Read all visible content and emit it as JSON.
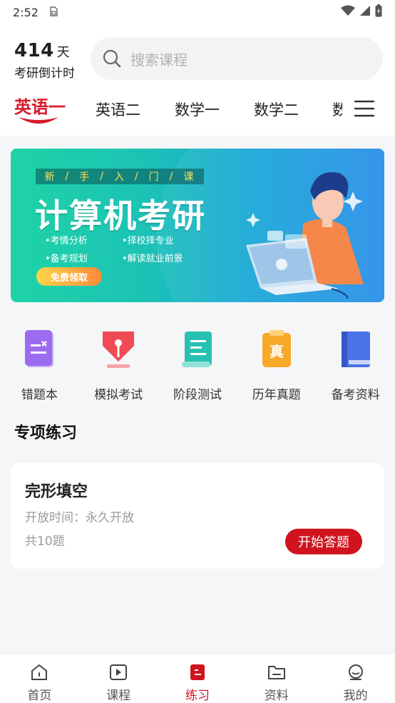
{
  "status_bar": {
    "time": "2:52"
  },
  "countdown": {
    "days": "414",
    "unit": "天",
    "label": "考研倒计时"
  },
  "search": {
    "placeholder": "搜索课程",
    "icon": "search-icon"
  },
  "subject_tabs": [
    {
      "label": "英语一",
      "active": true
    },
    {
      "label": "英语二",
      "active": false
    },
    {
      "label": "数学一",
      "active": false
    },
    {
      "label": "数学二",
      "active": false
    },
    {
      "label": "数",
      "active": false
    }
  ],
  "banner": {
    "tagline": [
      "新",
      "/",
      "手",
      "/",
      "入",
      "/",
      "门",
      "/",
      "课"
    ],
    "headline": "计算机考研",
    "bullets": [
      "•考情分析",
      "•择校择专业",
      "•备考规划",
      "•解读就业前景"
    ],
    "cta": "免费领取"
  },
  "quick_links": [
    {
      "label": "错题本",
      "icon": "notebook-icon",
      "color": "#9b6cf0"
    },
    {
      "label": "模拟考试",
      "icon": "pen-nib-icon",
      "color": "#f04b55"
    },
    {
      "label": "阶段测试",
      "icon": "scroll-icon",
      "color": "#26c1b1"
    },
    {
      "label": "历年真题",
      "icon": "clipboard-icon",
      "color": "#f7a928"
    },
    {
      "label": "备考资料",
      "icon": "book-icon",
      "color": "#4b72e8"
    }
  ],
  "section": {
    "title": "专项练习"
  },
  "practice_card": {
    "title": "完形填空",
    "open_time": "开放时间：永久开放",
    "count": "共10题",
    "button": "开始答题"
  },
  "bottom_nav": [
    {
      "label": "首页",
      "icon": "home-icon",
      "active": false
    },
    {
      "label": "课程",
      "icon": "play-icon",
      "active": false
    },
    {
      "label": "练习",
      "icon": "practice-icon",
      "active": true
    },
    {
      "label": "资料",
      "icon": "folder-icon",
      "active": false
    },
    {
      "label": "我的",
      "icon": "profile-icon",
      "active": false
    }
  ],
  "colors": {
    "accent": "#d0141f",
    "background": "#f5f6f8"
  }
}
